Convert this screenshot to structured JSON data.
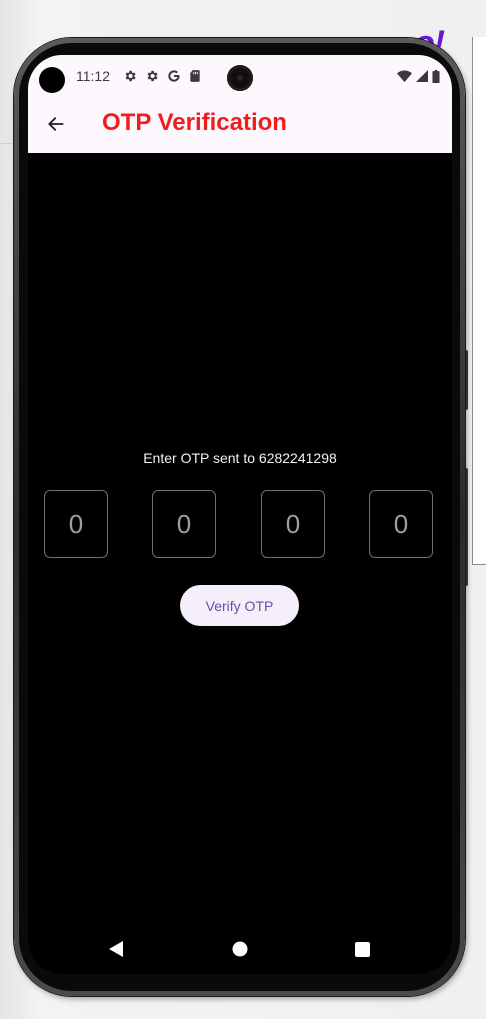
{
  "status_bar": {
    "time": "11:12",
    "left_icons": [
      "settings-icon",
      "settings-icon",
      "google-icon",
      "sd-card-icon"
    ],
    "right_icons": [
      "wifi-icon",
      "signal-icon",
      "battery-icon"
    ]
  },
  "app_bar": {
    "title": "OTP Verification",
    "title_color": "#f11d1d",
    "background": "#fdf7fe",
    "back_icon": "arrow-back-icon"
  },
  "otp": {
    "prompt": "Enter OTP sent to 6282241298",
    "digits": [
      "0",
      "0",
      "0",
      "0"
    ]
  },
  "verify_button": {
    "label": "Verify OTP",
    "text_color": "#6a4ea8",
    "background": "#f5eefb"
  },
  "nav_bar": {
    "items": [
      "back-icon",
      "home-icon",
      "recents-icon"
    ]
  }
}
